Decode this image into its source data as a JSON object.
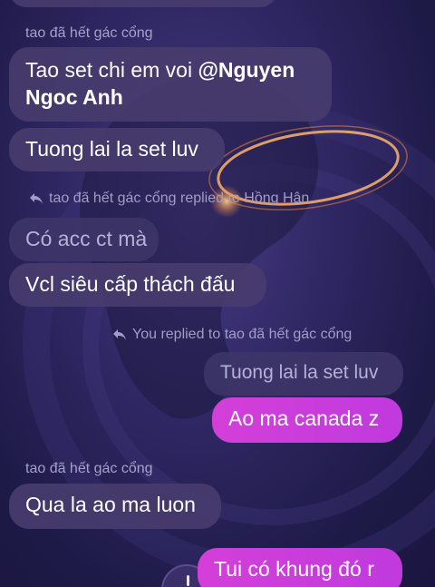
{
  "colors": {
    "background": "#2a2358",
    "incoming_bubble": "#483c6e",
    "outgoing_bubble": "#cf3ed9",
    "meta_text": "#a7a0c9"
  },
  "messages": {
    "sender_1": "tao đã hết gác cổng",
    "bubble_1_line1_pre": "Tao set chi em voi ",
    "bubble_1_mention_line1": "@Nguyen",
    "bubble_1_mention_line2": "Ngoc Anh",
    "bubble_2": "Tuong lai la set luv",
    "reply_context_1": "tao đã hết gác cổng replied to Hồng Hân",
    "reply_quote_1": "Có acc ct mà",
    "bubble_3": "Vcl siêu cấp thách đấu",
    "reply_context_2": "You replied to tao đã hết gác cổng",
    "reply_quote_2": "Tuong lai la set luv",
    "bubble_mine_1": "Ao ma canada z",
    "sender_2": "tao đã hết gác cổng",
    "bubble_4": "Qua la ao ma luon",
    "bubble_mine_2": "Tui có khung đó r"
  },
  "icons": {
    "reply": "reply-arrow-icon"
  }
}
